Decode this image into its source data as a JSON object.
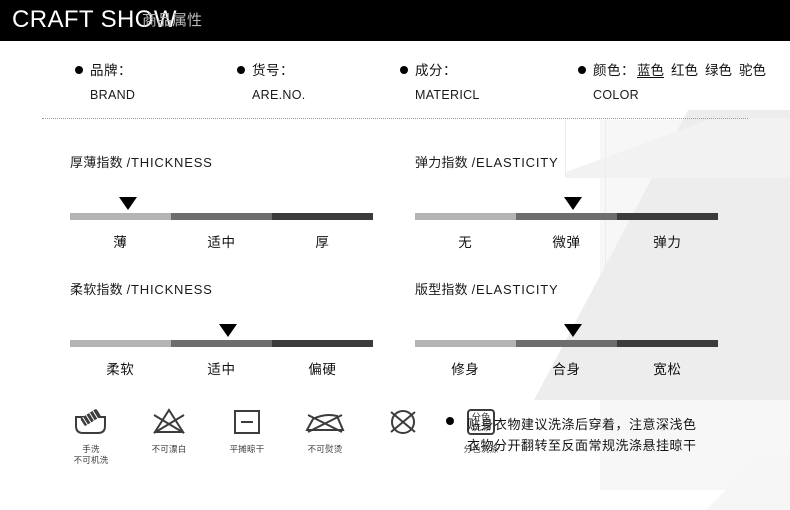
{
  "header": {
    "title": "CRAFT SHOW",
    "subtitle": "商品属性"
  },
  "attributes": [
    {
      "label": "品牌：",
      "en": "BRAND"
    },
    {
      "label": "货号：",
      "en": "ARE.NO."
    },
    {
      "label": "成分：",
      "en": "MATERICL"
    },
    {
      "label": "颜色：",
      "en": "COLOR"
    }
  ],
  "colors": {
    "options": [
      "蓝色",
      "红色",
      "绿色",
      "驼色"
    ],
    "selected": "蓝色"
  },
  "indexes": [
    {
      "title_cn": "厚薄指数",
      "title_en": "/THICKNESS",
      "labels": [
        "薄",
        "适中",
        "厚"
      ],
      "marker_percent": 19
    },
    {
      "title_cn": "弹力指数",
      "title_en": "/ELASTICITY",
      "labels": [
        "无",
        "微弹",
        "弹力"
      ],
      "marker_percent": 52
    },
    {
      "title_cn": "柔软指数",
      "title_en": "/THICKNESS",
      "labels": [
        "柔软",
        "适中",
        "偏硬"
      ],
      "marker_percent": 52
    },
    {
      "title_cn": "版型指数",
      "title_en": "/ELASTICITY",
      "labels": [
        "修身",
        "合身",
        "宽松"
      ],
      "marker_percent": 52
    }
  ],
  "care_icons": [
    {
      "icon": "hand-wash-icon",
      "caption": "手洗\n不可机洗"
    },
    {
      "icon": "no-bleach-icon",
      "caption": "不可漂白"
    },
    {
      "icon": "flat-dry-icon",
      "caption": "平摊晾干"
    },
    {
      "icon": "no-iron-icon",
      "caption": "不可熨烫"
    },
    {
      "icon": "no-dry-clean-icon",
      "caption": ""
    },
    {
      "icon": "separate-wash-icon",
      "caption": "分色洗涤"
    }
  ],
  "separate_wash_glyph": {
    "line1": "分色",
    "line2": "洗涤"
  },
  "care_note": {
    "line1": "贴身衣物建议洗涤后穿着，注意深浅色",
    "line2": "衣物分开翻转至反面常规洗涤悬挂晾干"
  },
  "theme": {
    "header_bg": "#000000",
    "header_text": "#ffffff",
    "header_sub_text": "#b9b9b9",
    "bar_light": "#b4b4b4",
    "bar_mid": "#6d6d6d",
    "bar_dark": "#3b3b3b",
    "text": "#111111",
    "watermark": "#f1f1f1"
  }
}
